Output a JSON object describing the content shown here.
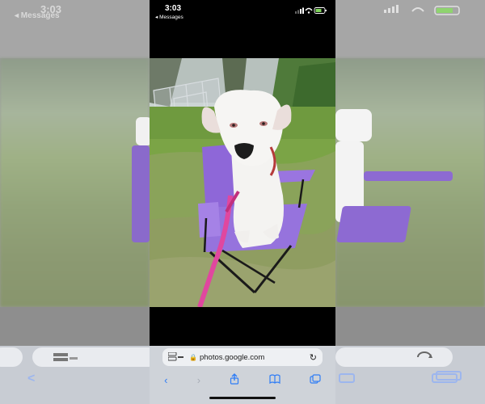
{
  "status_bar": {
    "time": "3:03",
    "back_label": "◂ Messages"
  },
  "browser": {
    "url": "photos.google.com",
    "lock_glyph": "🔒",
    "reload_glyph": "↻"
  },
  "nav": {
    "back": "‹",
    "forward": "›",
    "share": "⇪",
    "bookmarks": "📖",
    "tabs": "⧉"
  },
  "side_left": {
    "time": "3:03",
    "back_label": "◂ Messages",
    "back_nav": "<"
  },
  "colors": {
    "accent": "#2f7df6",
    "chair": "#8f6ad9",
    "leash": "#e0479f",
    "grass": "#78a43d"
  },
  "photo": {
    "alt_icons": [
      "dog-icon",
      "chair-icon",
      "leash-icon",
      "fence-icon",
      "tree-icon"
    ]
  }
}
